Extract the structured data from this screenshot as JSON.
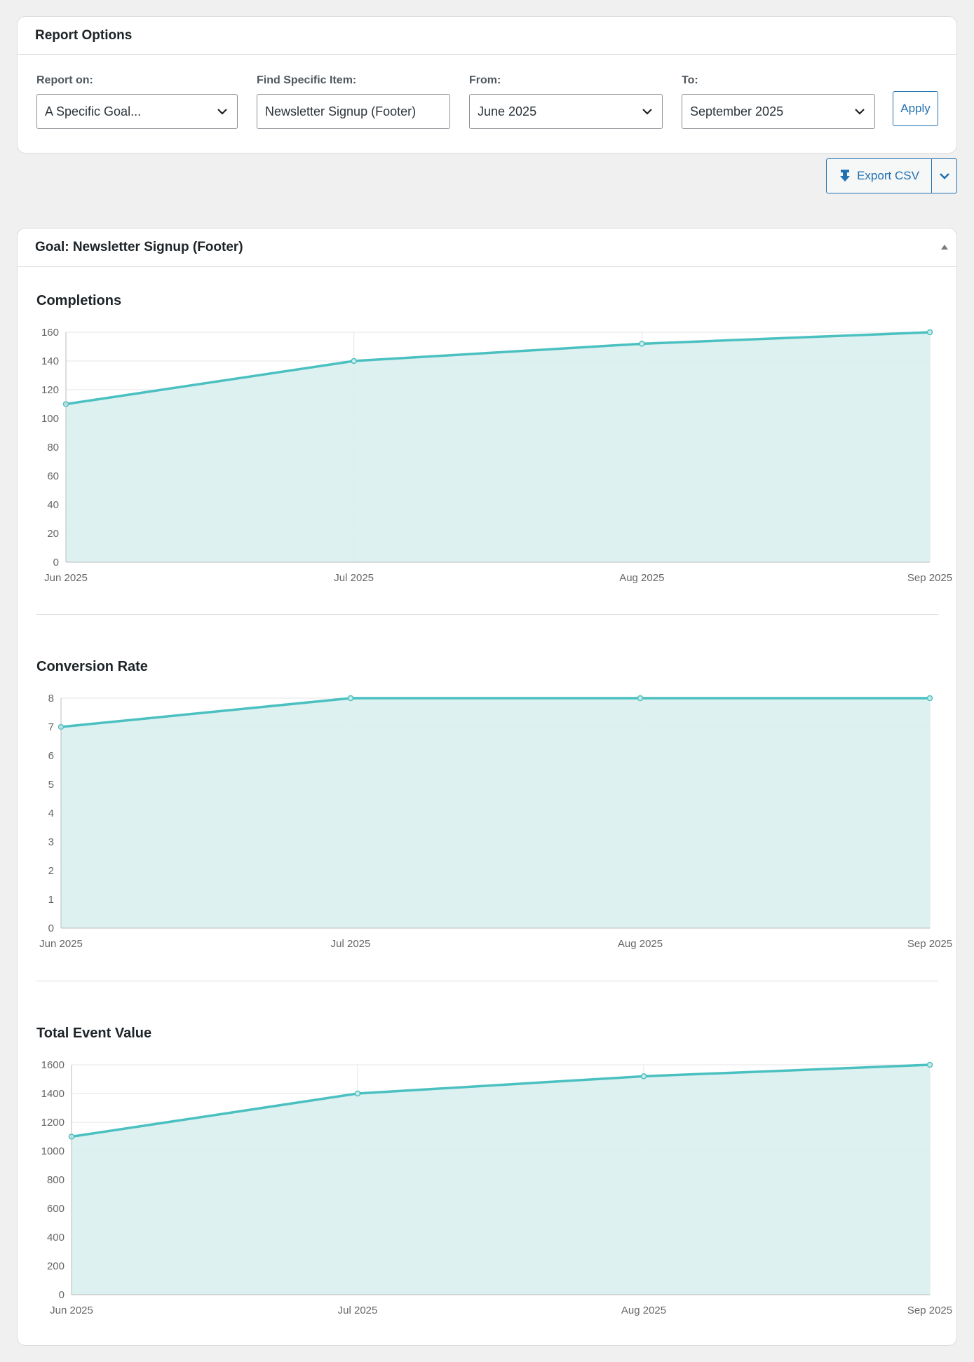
{
  "options": {
    "title": "Report Options",
    "report_on": {
      "label": "Report on:",
      "value": "A Specific Goal..."
    },
    "find_item": {
      "label": "Find Specific Item:",
      "value": "Newsletter Signup (Footer)"
    },
    "from": {
      "label": "From:",
      "value": "June 2025"
    },
    "to": {
      "label": "To:",
      "value": "September 2025"
    },
    "apply_label": "Apply"
  },
  "export": {
    "label": "Export CSV",
    "icon": "download-icon",
    "caret_icon": "chevron-down-icon"
  },
  "goal_panel": {
    "title": "Goal: Newsletter Signup (Footer)",
    "collapse_icon": "triangle-up-icon"
  },
  "colors": {
    "accent": "#2271b1",
    "series_line": "#4bc0c0",
    "series_fill": "#d9f0f0"
  },
  "chart_data": [
    {
      "type": "area",
      "title": "Completions",
      "x": [
        "Jun 2025",
        "Jul 2025",
        "Aug 2025",
        "Sep 2025"
      ],
      "series": [
        {
          "values": [
            110,
            140,
            152,
            160
          ]
        }
      ],
      "ylim": [
        0,
        160
      ],
      "yticks": [
        "0",
        "20",
        "40",
        "60",
        "80",
        "100",
        "120",
        "140",
        "160"
      ],
      "grid": true
    },
    {
      "type": "area",
      "title": "Conversion Rate",
      "x": [
        "Jun 2025",
        "Jul 2025",
        "Aug 2025",
        "Sep 2025"
      ],
      "series": [
        {
          "values": [
            7,
            8,
            8,
            8
          ]
        }
      ],
      "ylim": [
        0,
        8
      ],
      "yticks": [
        "0",
        "1",
        "2",
        "3",
        "4",
        "5",
        "6",
        "7",
        "8"
      ],
      "grid": true
    },
    {
      "type": "area",
      "title": "Total Event Value",
      "x": [
        "Jun 2025",
        "Jul 2025",
        "Aug 2025",
        "Sep 2025"
      ],
      "series": [
        {
          "values": [
            1100,
            1400,
            1520,
            1600
          ]
        }
      ],
      "ylim": [
        0,
        1600
      ],
      "yticks": [
        "0",
        "200",
        "400",
        "600",
        "800",
        "1000",
        "1200",
        "1400",
        "1600"
      ],
      "grid": true
    }
  ]
}
